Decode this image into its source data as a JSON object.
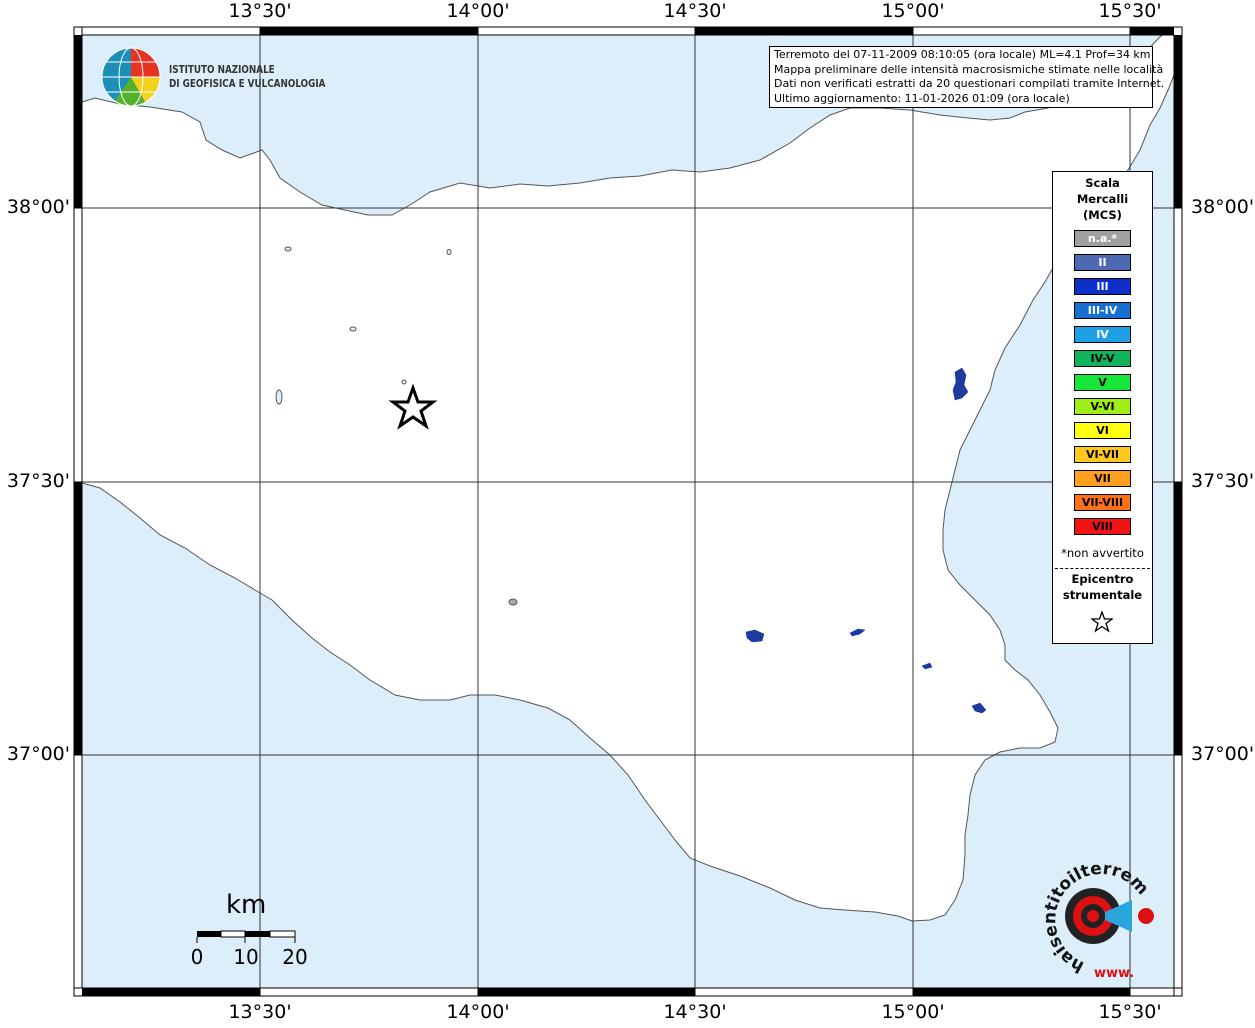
{
  "info_box": {
    "line1": "Terremoto del 07-11-2009 08:10:05 (ora locale) ML=4.1 Prof=34 km",
    "line2": "Mappa preliminare delle intensità macrosismiche stimate nelle località",
    "line3": "Dati non verificati estratti da 20 questionari compilati tramite Internet.",
    "line4": "Ultimo aggiornamento: 11-01-2026 01:09 (ora locale)"
  },
  "logos": {
    "ingv_line1": "ISTITUTO NAZIONALE",
    "ingv_line2": "DI GEOFISICA E VULCANOLOGIA",
    "hsit_text": "haisentitoilterremoto.it",
    "hsit_url": "www."
  },
  "axes": {
    "longitude_ticks": [
      "13°30'",
      "14°00'",
      "14°30'",
      "15°00'",
      "15°30'"
    ],
    "latitude_ticks": [
      "38°00'",
      "37°30'",
      "37°00'"
    ]
  },
  "legend": {
    "title_line1": "Scala",
    "title_line2": "Mercalli",
    "title_line3": "(MCS)",
    "classes": [
      {
        "label": "n.a.*",
        "color": "#a0a0a0",
        "text": "#ffffff"
      },
      {
        "label": "II",
        "color": "#4d69b4",
        "text": "#ffffff"
      },
      {
        "label": "III",
        "color": "#0c30c8",
        "text": "#ffffff"
      },
      {
        "label": "III-IV",
        "color": "#1670d2",
        "text": "#ffffff"
      },
      {
        "label": "IV",
        "color": "#1ea0e6",
        "text": "#ffffff"
      },
      {
        "label": "IV-V",
        "color": "#11b45a",
        "text": "#000000"
      },
      {
        "label": "V",
        "color": "#18e638",
        "text": "#000000"
      },
      {
        "label": "V-VI",
        "color": "#a0ee18",
        "text": "#000000"
      },
      {
        "label": "VI",
        "color": "#ffff10",
        "text": "#000000"
      },
      {
        "label": "VI-VII",
        "color": "#ffc81e",
        "text": "#000000"
      },
      {
        "label": "VII",
        "color": "#ffa01e",
        "text": "#000000"
      },
      {
        "label": "VII-VIII",
        "color": "#ff7018",
        "text": "#000000"
      },
      {
        "label": "VIII",
        "color": "#f01414",
        "text": "#000000"
      }
    ],
    "note": "*non avvertito",
    "epicenter_line1": "Epicentro",
    "epicenter_line2": "strumentale",
    "epicenter_icon": "star-outline-icon"
  },
  "scale_bar": {
    "unit": "km",
    "labels": [
      "0",
      "10",
      "20"
    ]
  },
  "colors": {
    "sea": "#dbeefa",
    "land": "#ffffff",
    "coast": "#555555",
    "grid": "#333333",
    "frame": "#000000"
  },
  "epicenter": {
    "lon": 13.84,
    "lat": 37.63,
    "icon": "star-outline-icon"
  },
  "localities": [
    {
      "name": "",
      "intensity": "II"
    }
  ]
}
